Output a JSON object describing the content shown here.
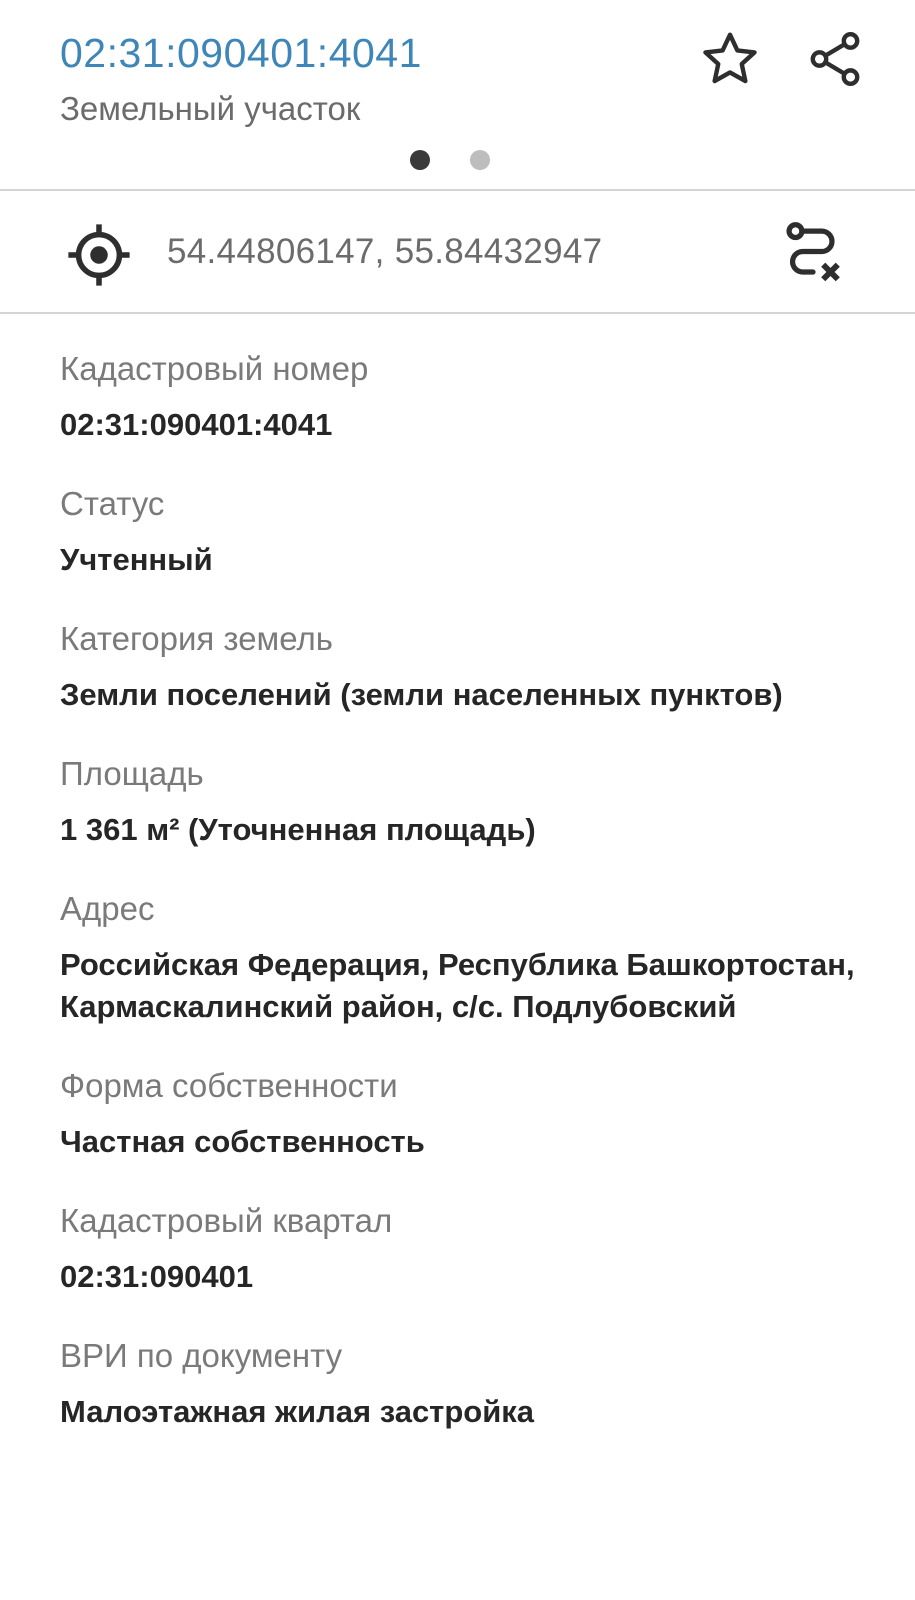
{
  "header": {
    "title": "02:31:090401:4041",
    "subtitle": "Земельный участок",
    "favorite_icon": "star-outline-icon",
    "share_icon": "share-icon",
    "page_indicator": {
      "total": 2,
      "active": 1
    }
  },
  "location": {
    "coordinates": "54.44806147, 55.84432947",
    "locate_icon": "crosshair-target-icon",
    "route_icon": "route-clear-icon"
  },
  "fields": [
    {
      "label": "Кадастровый номер",
      "value": "02:31:090401:4041"
    },
    {
      "label": "Статус",
      "value": "Учтенный"
    },
    {
      "label": "Категория земель",
      "value": "Земли поселений (земли населенных пунктов)"
    },
    {
      "label": "Площадь",
      "value": "1 361 м² (Уточненная площадь)"
    },
    {
      "label": "Адрес",
      "value": "Российская Федерация, Республика Башкортостан, Кармаскалинский район, с/с. Подлубовский"
    },
    {
      "label": "Форма собственности",
      "value": "Частная собственность"
    },
    {
      "label": "Кадастровый квартал",
      "value": "02:31:090401"
    },
    {
      "label": "ВРИ по документу",
      "value": "Малоэтажная жилая застройка"
    }
  ],
  "colors": {
    "title": "#3f86b8",
    "label": "#7a7a7a",
    "value": "#262626",
    "divider": "#d4d4d4"
  }
}
